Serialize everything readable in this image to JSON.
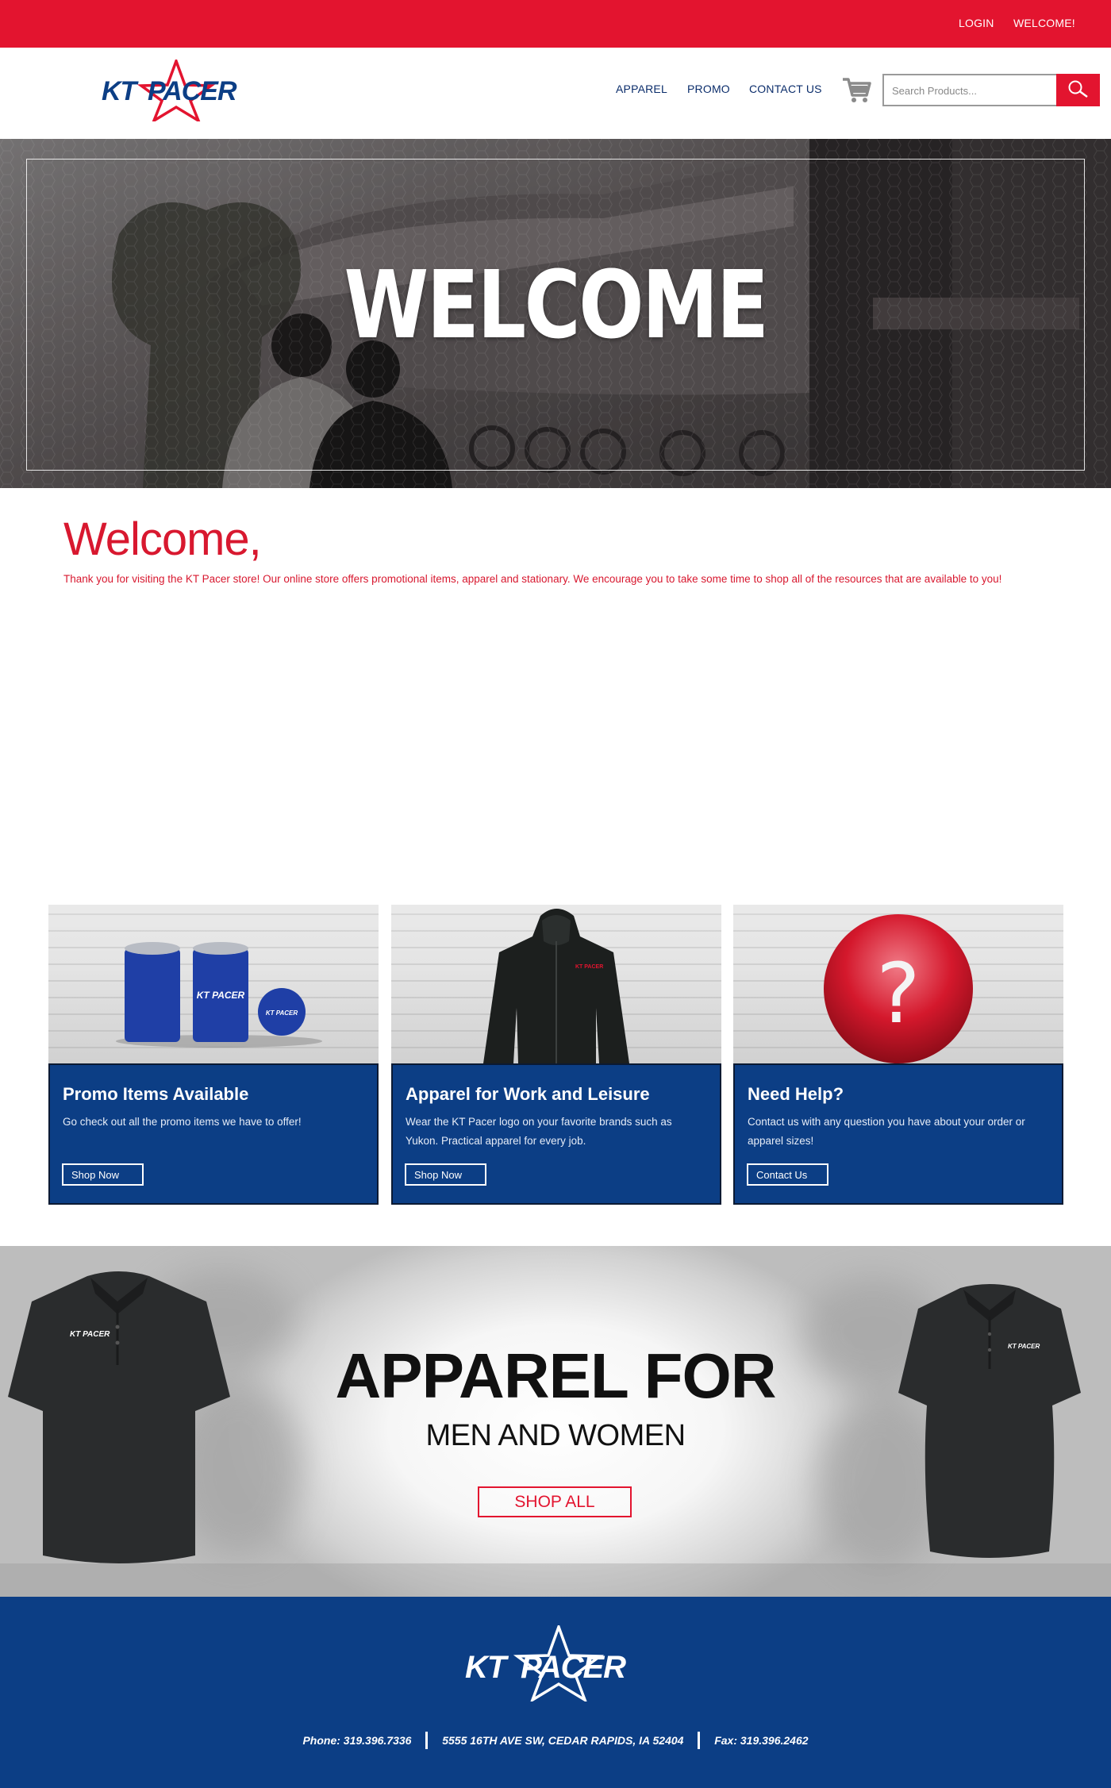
{
  "topbar": {
    "login": "LOGIN",
    "welcome": "WELCOME!"
  },
  "brand": {
    "name": "KT PACER",
    "blue": "#0c3e85",
    "red": "#e3142f"
  },
  "nav": {
    "apparel": "APPAREL",
    "promo": "PROMO",
    "contact": "CONTACT US"
  },
  "search": {
    "placeholder": "Search Products..."
  },
  "hero": {
    "title": "WELCOME"
  },
  "welcome": {
    "title": "Welcome,",
    "text": "Thank you for visiting the KT Pacer store! Our online store offers promotional items, apparel and stationary. We encourage you to take some time to shop all of the resources that are available to you!"
  },
  "cards": [
    {
      "title": "Promo Items Available",
      "text": "Go check out all the promo items we have to offer!",
      "button": "Shop Now"
    },
    {
      "title": "Apparel for Work and Leisure",
      "text": "Wear the KT Pacer logo on your favorite brands such as Yukon. Practical apparel for every job.",
      "button": "Shop Now"
    },
    {
      "title": "Need Help?",
      "text": "Contact us with any question you have about your order or apparel sizes!",
      "button": "Contact Us"
    }
  ],
  "banner": {
    "title": "APPAREL FOR",
    "subtitle": "MEN AND WOMEN",
    "button": "SHOP ALL"
  },
  "footer": {
    "phone": "Phone: 319.396.7336",
    "address": "5555 16TH AVE SW, CEDAR RAPIDS, IA 52404",
    "fax": "Fax: 319.396.2462"
  },
  "icons": {
    "cart": "cart-icon",
    "search": "search-icon",
    "question": "question-mark-icon",
    "star": "star-icon"
  }
}
